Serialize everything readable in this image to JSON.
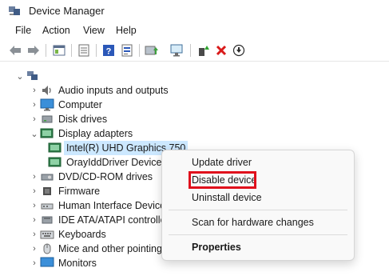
{
  "window": {
    "title": "Device Manager"
  },
  "menu": [
    "File",
    "Action",
    "View",
    "Help"
  ],
  "toolbar_icons": [
    "back-arrow-icon",
    "forward-arrow-icon",
    "properties-icon",
    "list-view-icon",
    "help-icon",
    "resources-icon",
    "update-driver-icon",
    "scan-hardware-icon",
    "enable-device-icon",
    "uninstall-icon",
    "download-icon"
  ],
  "tree": {
    "items": [
      {
        "label": "Audio inputs and outputs"
      },
      {
        "label": "Computer"
      },
      {
        "label": "Disk drives"
      },
      {
        "label": "Display adapters"
      },
      {
        "label": "Intel(R) UHD Graphics 750"
      },
      {
        "label": "OrayIddDriver Device"
      },
      {
        "label": "DVD/CD-ROM drives"
      },
      {
        "label": "Firmware"
      },
      {
        "label": "Human Interface Devices"
      },
      {
        "label": "IDE ATA/ATAPI controllers"
      },
      {
        "label": "Keyboards"
      },
      {
        "label": "Mice and other pointing devices"
      },
      {
        "label": "Monitors"
      }
    ]
  },
  "context_menu": {
    "update_driver": "Update driver",
    "disable_device": "Disable device",
    "uninstall_device": "Uninstall device",
    "scan_hardware": "Scan for hardware changes",
    "properties": "Properties"
  },
  "colors": {
    "selection": "#cce8ff",
    "highlight_box": "#e0101c",
    "accent": "#2d7dd2"
  }
}
